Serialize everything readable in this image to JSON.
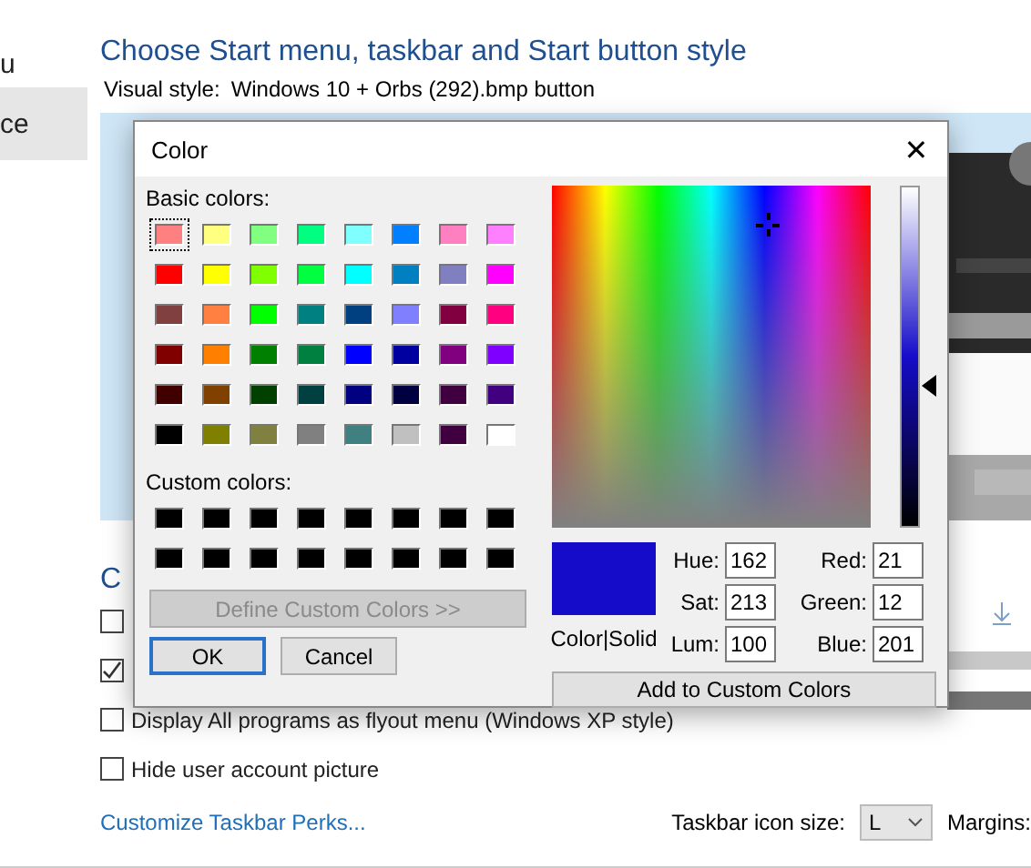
{
  "sidebar": {
    "items": [
      {
        "label": "u",
        "selected": false
      },
      {
        "label": "ce",
        "selected": true
      }
    ]
  },
  "section_title": "Choose Start menu, taskbar and Start button style",
  "visual_style": {
    "label": "Visual style:",
    "value": "Windows 10 + Orbs (292).bmp button"
  },
  "customize_heading": "C",
  "options": [
    {
      "checked": false
    },
    {
      "checked": true
    },
    {
      "label": "Display All programs as flyout menu (Windows XP style)",
      "checked": false
    },
    {
      "label": "Hide user account picture",
      "checked": false
    }
  ],
  "perks_link": "Customize Taskbar Perks...",
  "icon_size": {
    "label": "Taskbar icon size:",
    "value": "L"
  },
  "margins_label": "Margins:",
  "dialog": {
    "title": "Color",
    "close": "✕",
    "basic_label": "Basic colors:",
    "basic_colors": [
      {
        "color": "#ff8080",
        "selected": true
      },
      {
        "color": "#ffff80",
        "selected": false
      },
      {
        "color": "#80ff80",
        "selected": false
      },
      {
        "color": "#00ff80",
        "selected": false
      },
      {
        "color": "#80ffff",
        "selected": false
      },
      {
        "color": "#0080ff",
        "selected": false
      },
      {
        "color": "#ff80c0",
        "selected": false
      },
      {
        "color": "#ff80ff",
        "selected": false
      },
      {
        "color": "#ff0000",
        "selected": false
      },
      {
        "color": "#ffff00",
        "selected": false
      },
      {
        "color": "#80ff00",
        "selected": false
      },
      {
        "color": "#00ff40",
        "selected": false
      },
      {
        "color": "#00ffff",
        "selected": false
      },
      {
        "color": "#0080c0",
        "selected": false
      },
      {
        "color": "#8080c0",
        "selected": false
      },
      {
        "color": "#ff00ff",
        "selected": false
      },
      {
        "color": "#804040",
        "selected": false
      },
      {
        "color": "#ff8040",
        "selected": false
      },
      {
        "color": "#00ff00",
        "selected": false
      },
      {
        "color": "#008080",
        "selected": false
      },
      {
        "color": "#004080",
        "selected": false
      },
      {
        "color": "#8080ff",
        "selected": false
      },
      {
        "color": "#800040",
        "selected": false
      },
      {
        "color": "#ff0080",
        "selected": false
      },
      {
        "color": "#800000",
        "selected": false
      },
      {
        "color": "#ff8000",
        "selected": false
      },
      {
        "color": "#008000",
        "selected": false
      },
      {
        "color": "#008040",
        "selected": false
      },
      {
        "color": "#0000ff",
        "selected": false
      },
      {
        "color": "#0000a0",
        "selected": false
      },
      {
        "color": "#800080",
        "selected": false
      },
      {
        "color": "#8000ff",
        "selected": false
      },
      {
        "color": "#400000",
        "selected": false
      },
      {
        "color": "#804000",
        "selected": false
      },
      {
        "color": "#004000",
        "selected": false
      },
      {
        "color": "#004040",
        "selected": false
      },
      {
        "color": "#000080",
        "selected": false
      },
      {
        "color": "#000040",
        "selected": false
      },
      {
        "color": "#400040",
        "selected": false
      },
      {
        "color": "#400080",
        "selected": false
      },
      {
        "color": "#000000",
        "selected": false
      },
      {
        "color": "#808000",
        "selected": false
      },
      {
        "color": "#808040",
        "selected": false
      },
      {
        "color": "#808080",
        "selected": false
      },
      {
        "color": "#408080",
        "selected": false
      },
      {
        "color": "#c0c0c0",
        "selected": false
      },
      {
        "color": "#400040",
        "selected": false
      },
      {
        "color": "#ffffff",
        "selected": false
      }
    ],
    "custom_label": "Custom colors:",
    "custom_colors": [
      {
        "color": "#000000"
      },
      {
        "color": "#000000"
      },
      {
        "color": "#000000"
      },
      {
        "color": "#000000"
      },
      {
        "color": "#000000"
      },
      {
        "color": "#000000"
      },
      {
        "color": "#000000"
      },
      {
        "color": "#000000"
      },
      {
        "color": "#000000"
      },
      {
        "color": "#000000"
      },
      {
        "color": "#000000"
      },
      {
        "color": "#000000"
      },
      {
        "color": "#000000"
      },
      {
        "color": "#000000"
      },
      {
        "color": "#000000"
      },
      {
        "color": "#000000"
      }
    ],
    "define_button": {
      "label": "Define Custom Colors >>",
      "disabled": true
    },
    "ok_button": {
      "label": "OK",
      "selected": true
    },
    "cancel_button": {
      "label": "Cancel",
      "selected": false
    },
    "preview_label": "Color|Solid",
    "hsl_fields": [
      {
        "label": "Hue:",
        "value": "162"
      },
      {
        "label": "Sat:",
        "value": "213"
      },
      {
        "label": "Lum:",
        "value": "100"
      }
    ],
    "rgb_fields": [
      {
        "label": "Red:",
        "value": "21"
      },
      {
        "label": "Green:",
        "value": "12"
      },
      {
        "label": "Blue:",
        "value": "201"
      }
    ],
    "add_button": "Add to Custom Colors"
  }
}
